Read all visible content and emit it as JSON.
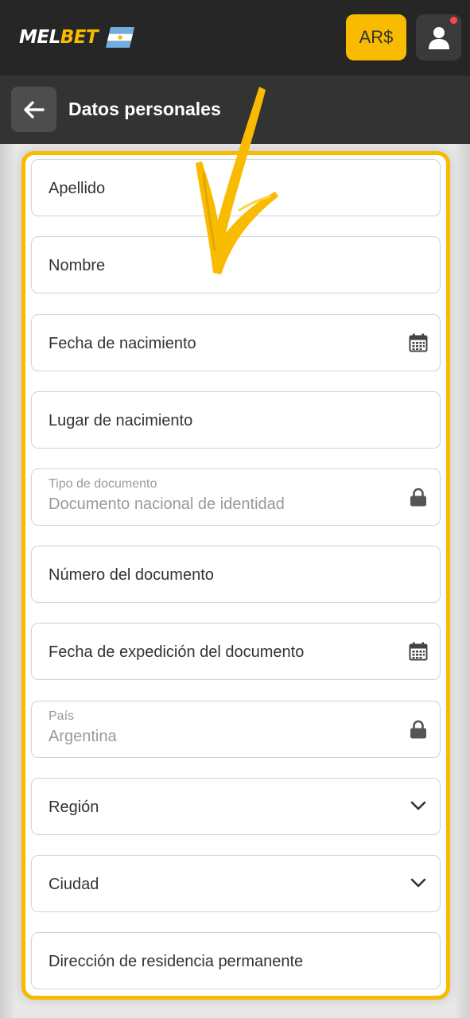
{
  "header": {
    "logo_mel": "MEL",
    "logo_bet": "BET",
    "currency": "AR$",
    "icons": {
      "flag": "argentina-flag-icon",
      "user": "user-icon",
      "notification": "notification-dot"
    }
  },
  "subheader": {
    "title": "Datos personales",
    "back_icon": "arrow-left-icon"
  },
  "form": {
    "accent_color": "#f8bb00",
    "fields": [
      {
        "label": "Apellido"
      },
      {
        "label": "Nombre"
      },
      {
        "label": "Fecha de nacimiento",
        "icon": "calendar-icon"
      },
      {
        "label": "Lugar de nacimiento"
      },
      {
        "label": "Tipo de documento",
        "value": "Documento nacional de identidad",
        "icon": "lock-icon"
      },
      {
        "label": "Número del documento"
      },
      {
        "label": "Fecha de expedición del documento",
        "icon": "calendar-icon"
      },
      {
        "label": "País",
        "value": "Argentina",
        "icon": "lock-icon"
      },
      {
        "label": "Región",
        "icon": "chevron-down-icon"
      },
      {
        "label": "Ciudad",
        "icon": "chevron-down-icon"
      },
      {
        "label": "Dirección de residencia permanente"
      }
    ]
  },
  "colors": {
    "topbar": "#262626",
    "subheader": "#333333",
    "brand_yellow": "#f8bb00",
    "notification": "#ff4747"
  }
}
